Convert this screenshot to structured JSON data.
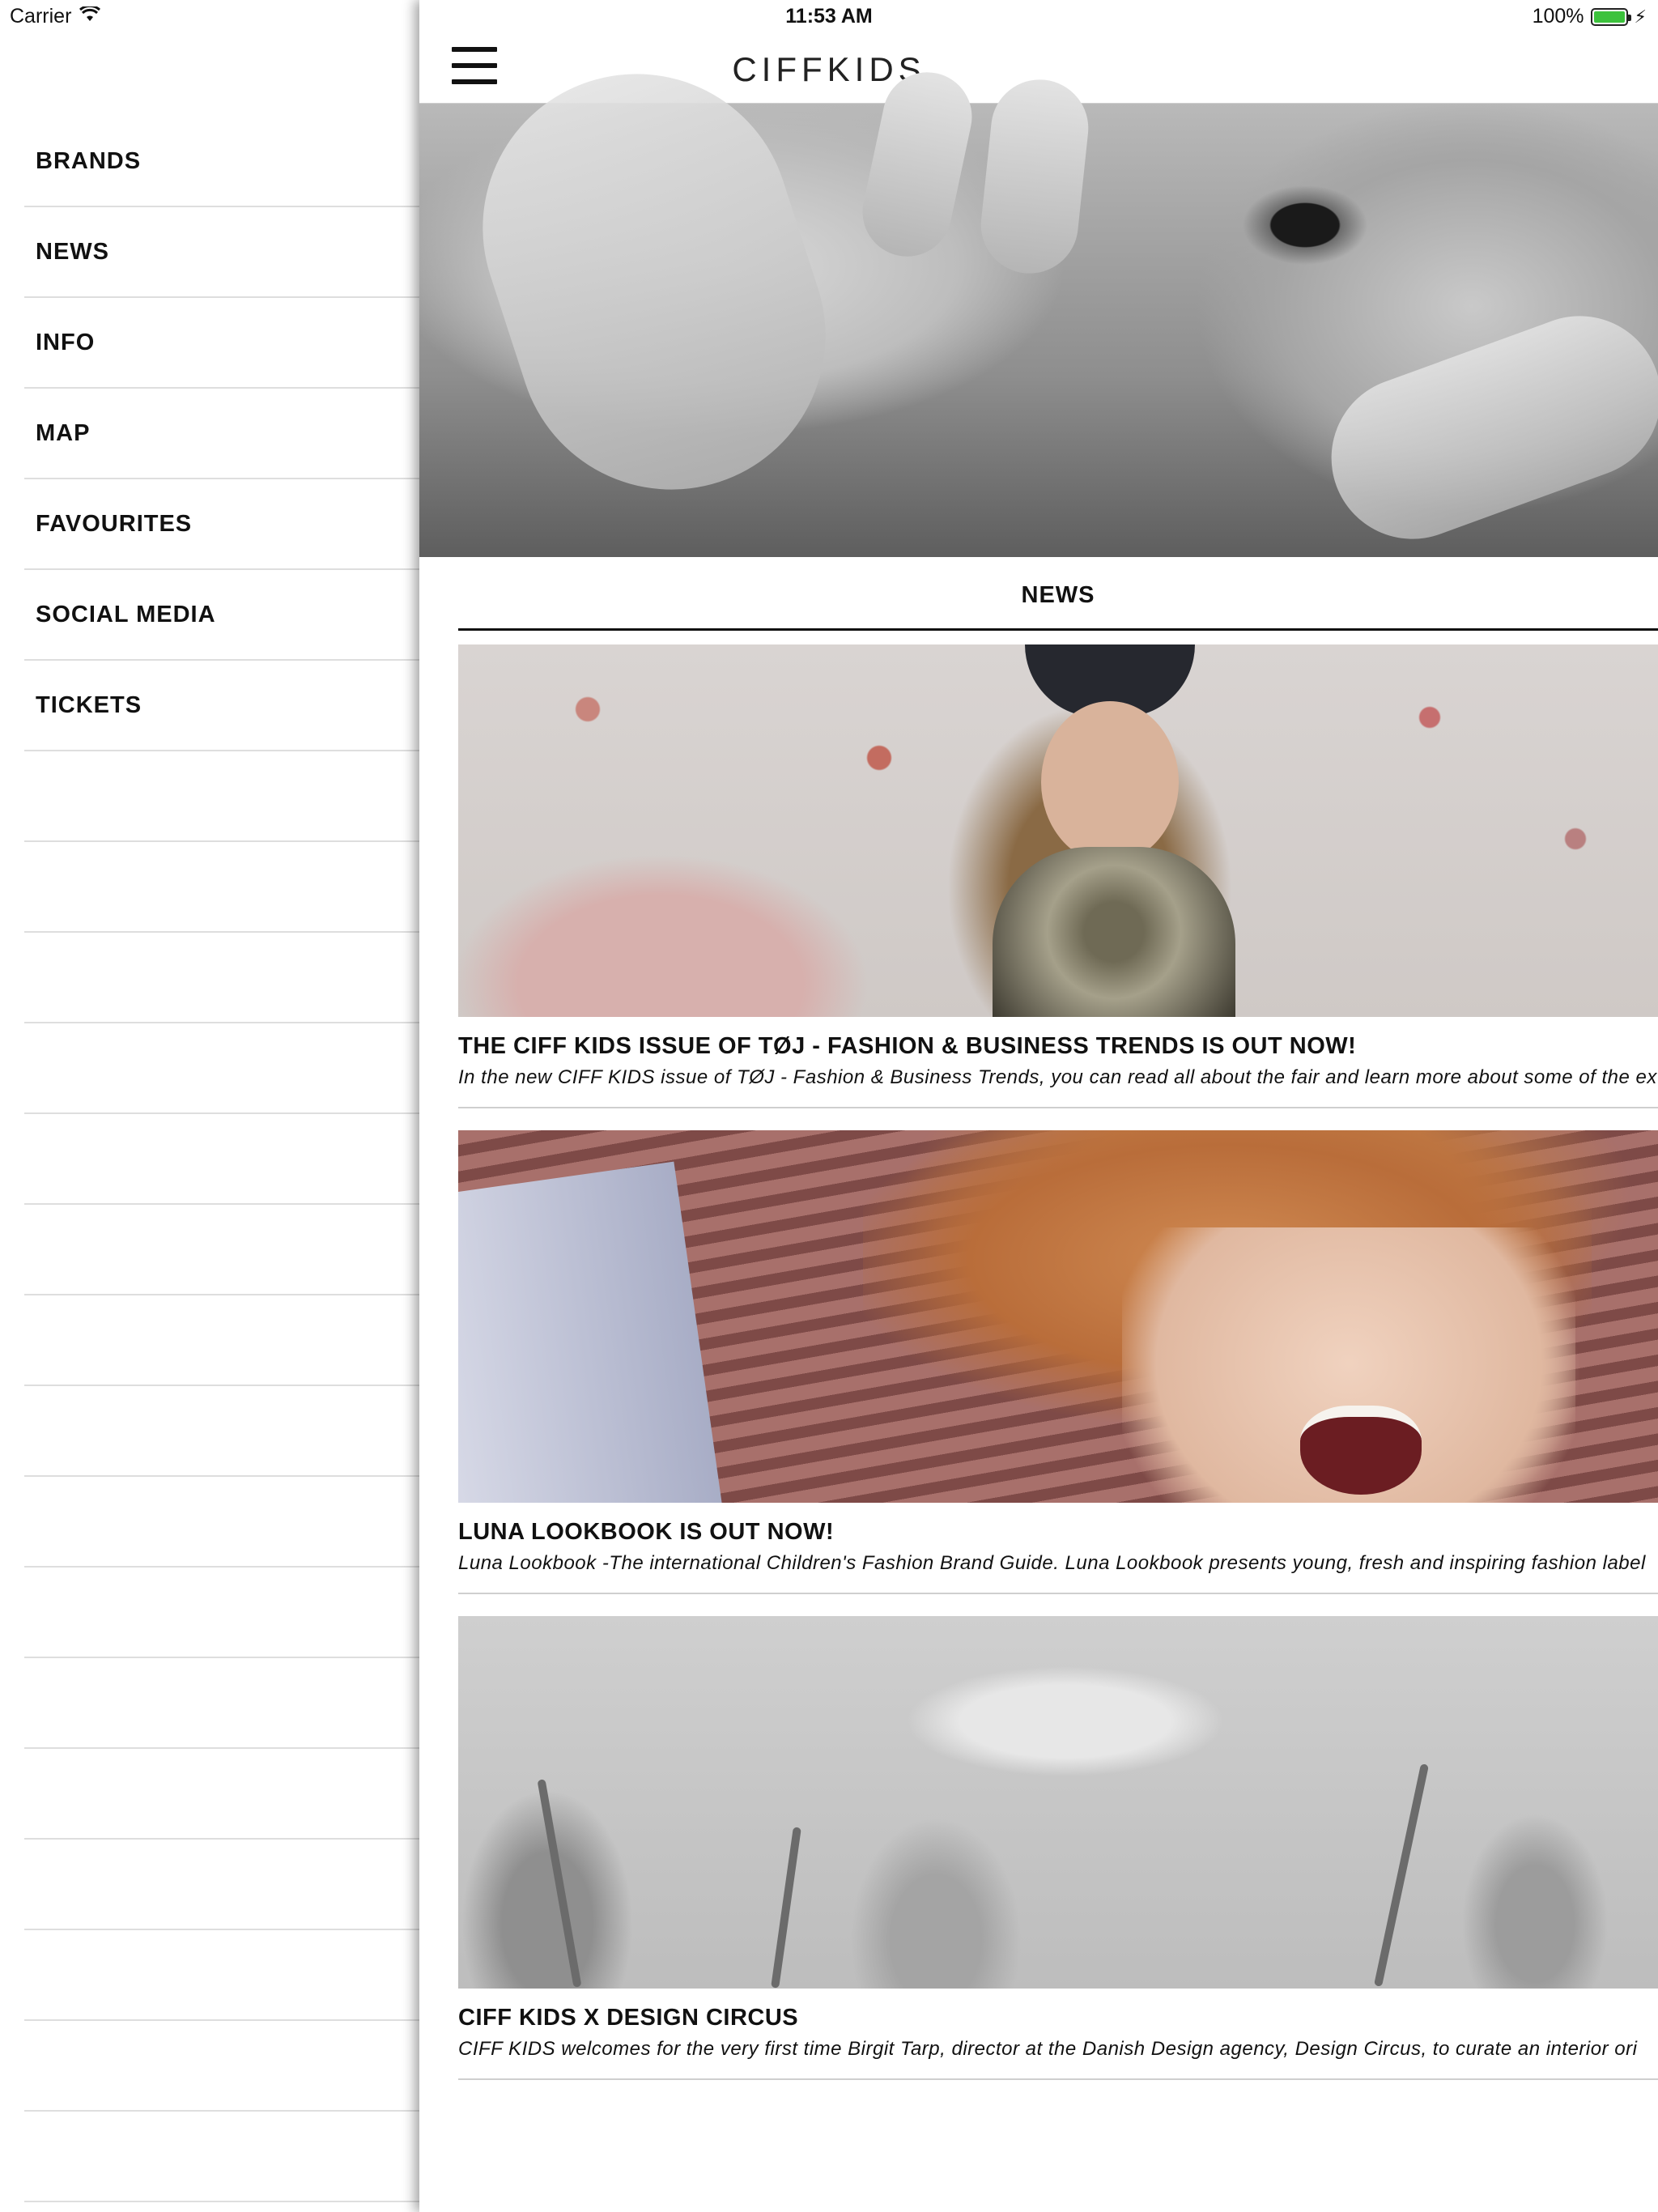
{
  "status_bar": {
    "carrier": "Carrier",
    "time": "11:53 AM",
    "battery": "100%",
    "battery_color": "#3cc23c"
  },
  "side_menu": {
    "items": [
      "BRANDS",
      "NEWS",
      "INFO",
      "MAP",
      "FAVOURITES",
      "SOCIAL MEDIA",
      "TICKETS"
    ]
  },
  "nav": {
    "logo": "CIFFKIDS",
    "menu_icon": "hamburger-icon"
  },
  "news": {
    "section_title": "NEWS",
    "articles": [
      {
        "title": "THE CIFF KIDS ISSUE OF TØJ - FASHION & BUSINESS TRENDS IS OUT NOW!",
        "excerpt": "In the new CIFF KIDS issue of TØJ - Fashion & Business Trends, you can read all about the fair and learn more about some of the ex"
      },
      {
        "title": "LUNA LOOKBOOK IS OUT NOW!",
        "excerpt": "Luna Lookbook -The international Children's Fashion Brand Guide. Luna Lookbook presents young, fresh and inspiring fashion label"
      },
      {
        "title": "CIFF KIDS X DESIGN CIRCUS",
        "excerpt": "CIFF KIDS welcomes for the very first time Birgit Tarp, director at the Danish Design agency, Design Circus, to curate an interior ori"
      }
    ]
  }
}
